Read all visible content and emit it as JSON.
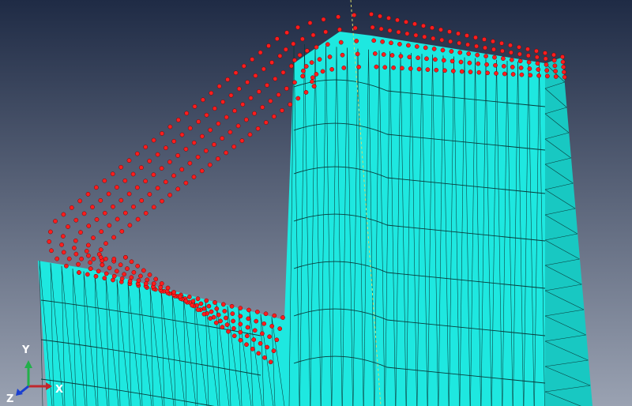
{
  "viewport": {
    "background_top": "#1f2b45",
    "background_bottom": "#9aa2b2"
  },
  "model": {
    "mesh_face_color": "#1ee8e0",
    "mesh_side_color": "#18c8c2",
    "mesh_dark_color": "#0fa5a0",
    "mesh_line_color": "#0a3a3a",
    "node_color": "#ff1e1e",
    "datum_line_color": "#d8d86a"
  },
  "triad": {
    "x_label": "X",
    "y_label": "Y",
    "z_label": "Z",
    "x_color": "#c0282d",
    "y_color": "#22b04a",
    "z_color": "#1a3fd0"
  }
}
